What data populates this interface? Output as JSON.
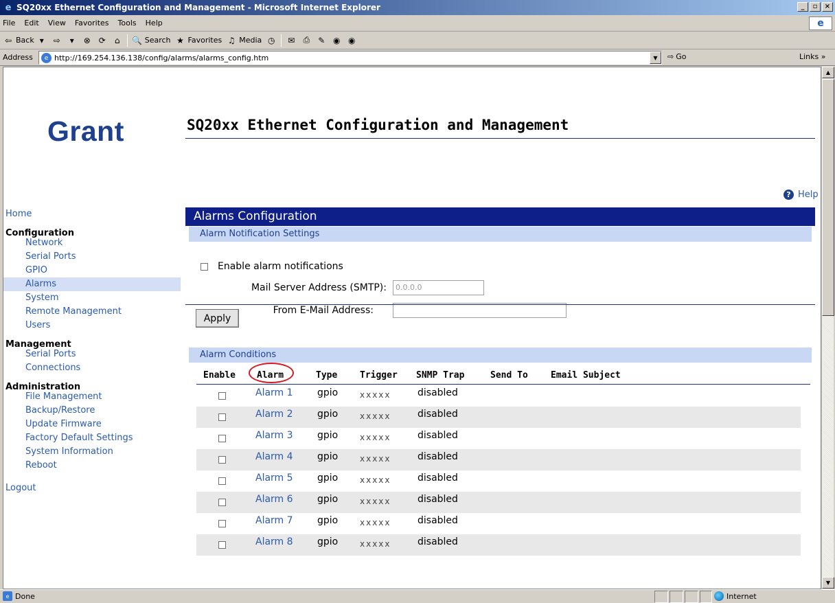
{
  "window": {
    "title": "SQ20xx Ethernet Configuration and Management - Microsoft Internet Explorer",
    "buttons": [
      "_",
      "▫",
      "×"
    ]
  },
  "menu": [
    "File",
    "Edit",
    "View",
    "Favorites",
    "Tools",
    "Help"
  ],
  "toolbar": {
    "back": "Back",
    "search": "Search",
    "favorites": "Favorites",
    "media": "Media"
  },
  "address": {
    "label": "Address",
    "url": "http://169.254.136.138/config/alarms/alarms_config.htm",
    "go": "Go",
    "links": "Links »"
  },
  "page": {
    "logo": "Grant",
    "title": "SQ20xx Ethernet Configuration and Management",
    "help": "Help"
  },
  "nav": {
    "home": "Home",
    "configuration": {
      "heading": "Configuration",
      "items": [
        "Network",
        "Serial Ports",
        "GPIO",
        "Alarms",
        "System",
        "Remote Management",
        "Users"
      ]
    },
    "management": {
      "heading": "Management",
      "items": [
        "Serial Ports",
        "Connections"
      ]
    },
    "administration": {
      "heading": "Administration",
      "items": [
        "File Management",
        "Backup/Restore",
        "Update Firmware",
        "Factory Default Settings",
        "System Information",
        "Reboot"
      ]
    },
    "logout": "Logout"
  },
  "panel": {
    "title": "Alarms Configuration",
    "notification_heading": "Alarm Notification Settings",
    "enable_label": "Enable alarm notifications",
    "smtp_label": "Mail Server Address (SMTP):",
    "smtp_value": "0.0.0.0",
    "from_label": "From E-Mail Address:",
    "from_value": "",
    "apply": "Apply",
    "conditions_heading": "Alarm Conditions"
  },
  "table": {
    "columns": [
      "Enable",
      "Alarm",
      "Type",
      "Trigger",
      "SNMP Trap",
      "Send To",
      "Email Subject"
    ],
    "rows": [
      {
        "alarm": "Alarm 1",
        "type": "gpio",
        "trigger": "xxxxx",
        "snmp": "disabled"
      },
      {
        "alarm": "Alarm 2",
        "type": "gpio",
        "trigger": "xxxxx",
        "snmp": "disabled"
      },
      {
        "alarm": "Alarm 3",
        "type": "gpio",
        "trigger": "xxxxx",
        "snmp": "disabled"
      },
      {
        "alarm": "Alarm 4",
        "type": "gpio",
        "trigger": "xxxxx",
        "snmp": "disabled"
      },
      {
        "alarm": "Alarm 5",
        "type": "gpio",
        "trigger": "xxxxx",
        "snmp": "disabled"
      },
      {
        "alarm": "Alarm 6",
        "type": "gpio",
        "trigger": "xxxxx",
        "snmp": "disabled"
      },
      {
        "alarm": "Alarm 7",
        "type": "gpio",
        "trigger": "xxxxx",
        "snmp": "disabled"
      },
      {
        "alarm": "Alarm 8",
        "type": "gpio",
        "trigger": "xxxxx",
        "snmp": "disabled"
      }
    ]
  },
  "status": {
    "text": "Done",
    "zone": "Internet"
  },
  "colors": {
    "panel_header": "#0e1f8a",
    "subheader": "#c8d8f4",
    "link": "#2a5ab0",
    "highlight_circle": "#d81820"
  }
}
